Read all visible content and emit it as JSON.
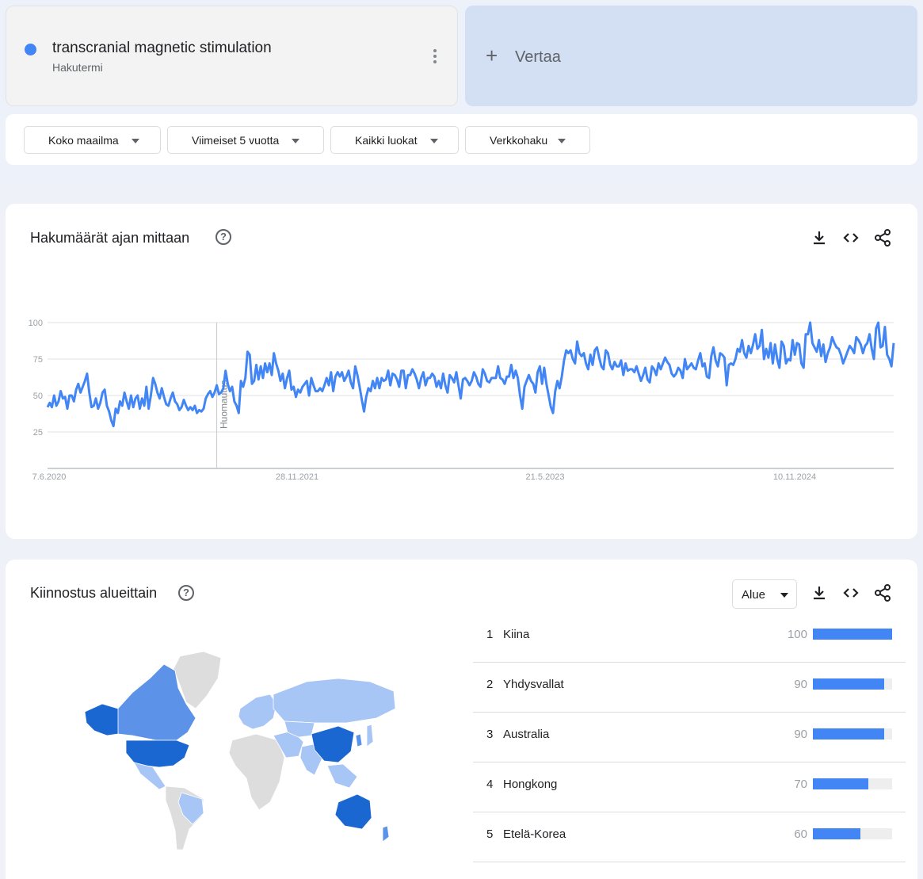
{
  "term": {
    "name": "transcranial magnetic stimulation",
    "type": "Hakutermi",
    "color": "#4285f4"
  },
  "compare": {
    "plus": "+",
    "label": "Vertaa"
  },
  "filters": [
    {
      "label": "Koko maailma"
    },
    {
      "label": "Viimeiset 5 vuotta"
    },
    {
      "label": "Kaikki luokat"
    },
    {
      "label": "Verkkohaku"
    }
  ],
  "interest_over_time": {
    "title": "Hakumäärät ajan mittaan",
    "help": "?",
    "note": "Huomautus"
  },
  "interest_by_region": {
    "title": "Kiinnostus alueittain",
    "help": "?",
    "resolution": "Alue",
    "regions": [
      {
        "rank": "1",
        "name": "Kiina",
        "value": 100
      },
      {
        "rank": "2",
        "name": "Yhdysvallat",
        "value": 90
      },
      {
        "rank": "3",
        "name": "Australia",
        "value": 90
      },
      {
        "rank": "4",
        "name": "Hongkong",
        "value": 70
      },
      {
        "rank": "5",
        "name": "Etelä-Korea",
        "value": 60
      }
    ],
    "map_colors": {
      "high": "#1a67d2",
      "mid": "#5c93e8",
      "low": "#a7c5f5",
      "none": "#dddddd"
    }
  },
  "chart_data": {
    "type": "line",
    "x_ticks": [
      "7.6.2020",
      "28.11.2021",
      "21.5.2023",
      "10.11.2024"
    ],
    "y_ticks": [
      100,
      75,
      50,
      25
    ],
    "ylim": [
      0,
      100
    ],
    "grid": true,
    "note_x_index": 77,
    "series": [
      {
        "color": "#4285f4",
        "values": [
          42,
          45,
          42,
          50,
          43,
          46,
          53,
          48,
          49,
          41,
          50,
          50,
          46,
          54,
          58,
          52,
          56,
          60,
          65,
          52,
          42,
          43,
          48,
          41,
          45,
          52,
          54,
          43,
          39,
          33,
          29,
          41,
          38,
          46,
          43,
          52,
          46,
          41,
          50,
          42,
          48,
          50,
          41,
          48,
          43,
          56,
          41,
          50,
          62,
          58,
          52,
          48,
          55,
          49,
          44,
          43,
          48,
          52,
          46,
          44,
          40,
          42,
          47,
          43,
          40,
          42,
          40,
          43,
          38,
          40,
          39,
          41,
          48,
          51,
          53,
          49,
          52,
          57,
          51,
          52,
          55,
          67,
          58,
          53,
          56,
          46,
          43,
          38,
          60,
          56,
          62,
          80,
          78,
          58,
          60,
          71,
          61,
          70,
          62,
          72,
          66,
          72,
          64,
          79,
          72,
          67,
          60,
          65,
          55,
          62,
          67,
          54,
          56,
          49,
          54,
          52,
          56,
          58,
          60,
          50,
          62,
          57,
          53,
          53,
          55,
          53,
          57,
          62,
          57,
          66,
          53,
          63,
          66,
          63,
          66,
          60,
          63,
          67,
          59,
          55,
          70,
          64,
          56,
          47,
          39,
          49,
          55,
          53,
          60,
          55,
          62,
          55,
          62,
          60,
          61,
          67,
          57,
          65,
          64,
          61,
          56,
          67,
          67,
          55,
          64,
          64,
          68,
          65,
          61,
          55,
          62,
          66,
          57,
          62,
          62,
          65,
          63,
          56,
          60,
          55,
          65,
          57,
          52,
          64,
          62,
          59,
          66,
          57,
          48,
          61,
          62,
          60,
          57,
          60,
          66,
          63,
          58,
          56,
          68,
          65,
          60,
          59,
          62,
          62,
          62,
          70,
          62,
          61,
          58,
          63,
          63,
          71,
          62,
          67,
          62,
          50,
          41,
          56,
          60,
          64,
          60,
          58,
          52,
          66,
          70,
          58,
          69,
          58,
          50,
          42,
          38,
          53,
          60,
          55,
          63,
          74,
          81,
          79,
          81,
          75,
          72,
          87,
          79,
          77,
          79,
          72,
          68,
          78,
          71,
          81,
          83,
          76,
          70,
          68,
          81,
          79,
          71,
          68,
          73,
          70,
          70,
          74,
          64,
          72,
          67,
          68,
          68,
          66,
          70,
          65,
          60,
          64,
          69,
          61,
          59,
          70,
          68,
          64,
          72,
          68,
          72,
          76,
          73,
          71,
          65,
          63,
          65,
          69,
          67,
          62,
          75,
          68,
          70,
          72,
          69,
          68,
          74,
          79,
          70,
          72,
          63,
          62,
          77,
          83,
          74,
          70,
          79,
          78,
          76,
          57,
          71,
          72,
          71,
          75,
          82,
          80,
          88,
          79,
          76,
          84,
          79,
          85,
          92,
          82,
          84,
          95,
          75,
          82,
          76,
          86,
          72,
          85,
          75,
          69,
          87,
          84,
          72,
          75,
          74,
          88,
          78,
          86,
          85,
          72,
          69,
          92,
          92,
          100,
          86,
          83,
          80,
          88,
          77,
          85,
          73,
          79,
          83,
          90,
          86,
          83,
          82,
          78,
          72,
          76,
          80,
          84,
          82,
          79,
          90,
          88,
          85,
          79,
          84,
          86,
          92,
          82,
          75,
          96,
          100,
          83,
          84,
          97,
          78,
          75,
          70,
          86
        ]
      }
    ]
  }
}
